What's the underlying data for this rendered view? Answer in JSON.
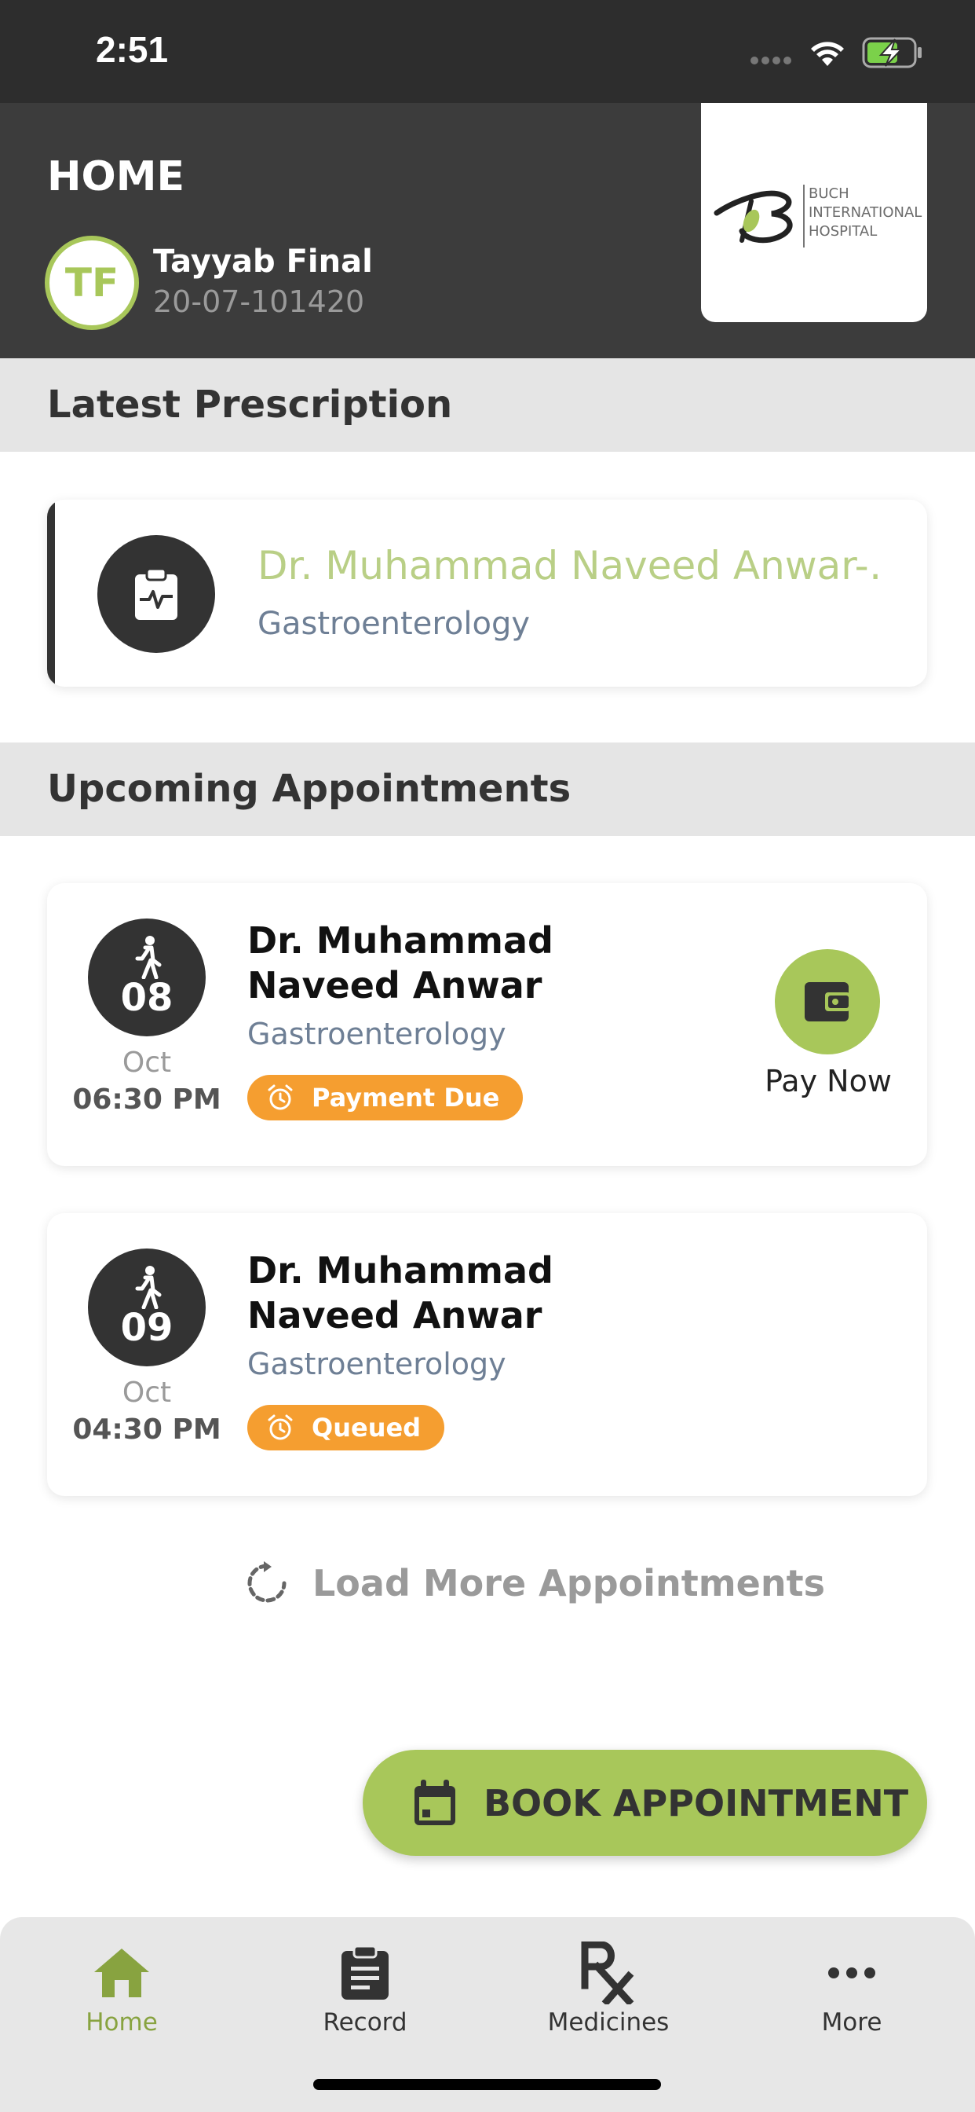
{
  "status_bar": {
    "time": "2:51"
  },
  "header": {
    "title": "HOME",
    "avatar_initials": "TF",
    "user_name": "Tayyab Final",
    "user_id": "20-07-101420",
    "logo_lines": [
      "BUCH",
      "INTERNATIONAL",
      "HOSPITAL"
    ]
  },
  "latest_prescription": {
    "section_title": "Latest Prescription",
    "doctor": "Dr. Muhammad Naveed Anwar-…",
    "specialty": "Gastroenterology",
    "icon": "clipboard-pulse-icon"
  },
  "upcoming": {
    "section_title": "Upcoming Appointments",
    "appointments": [
      {
        "day": "08",
        "month": "Oct",
        "time": "06:30 PM",
        "doctor": "Dr. Muhammad Naveed Anwar",
        "specialty": "Gastroenterology",
        "status": "Payment Due",
        "action_label": "Pay Now"
      },
      {
        "day": "09",
        "month": "Oct",
        "time": "04:30 PM",
        "doctor": "Dr. Muhammad Naveed Anwar",
        "specialty": "Gastroenterology",
        "status": "Queued"
      }
    ],
    "load_more": "Load More Appointments"
  },
  "book_button": "BOOK APPOINTMENT",
  "tabs": [
    {
      "label": "Home",
      "icon": "home-icon",
      "active": true
    },
    {
      "label": "Record",
      "icon": "clipboard-icon",
      "active": false
    },
    {
      "label": "Medicines",
      "icon": "rx-icon",
      "active": false
    },
    {
      "label": "More",
      "icon": "more-dots-icon",
      "active": false
    }
  ],
  "colors": {
    "accent": "#a8c75a",
    "header_bg": "#3c3c3c",
    "badge": "#f59e30",
    "doctor_link": "#b9cf86",
    "specialty": "#6e7f95"
  }
}
